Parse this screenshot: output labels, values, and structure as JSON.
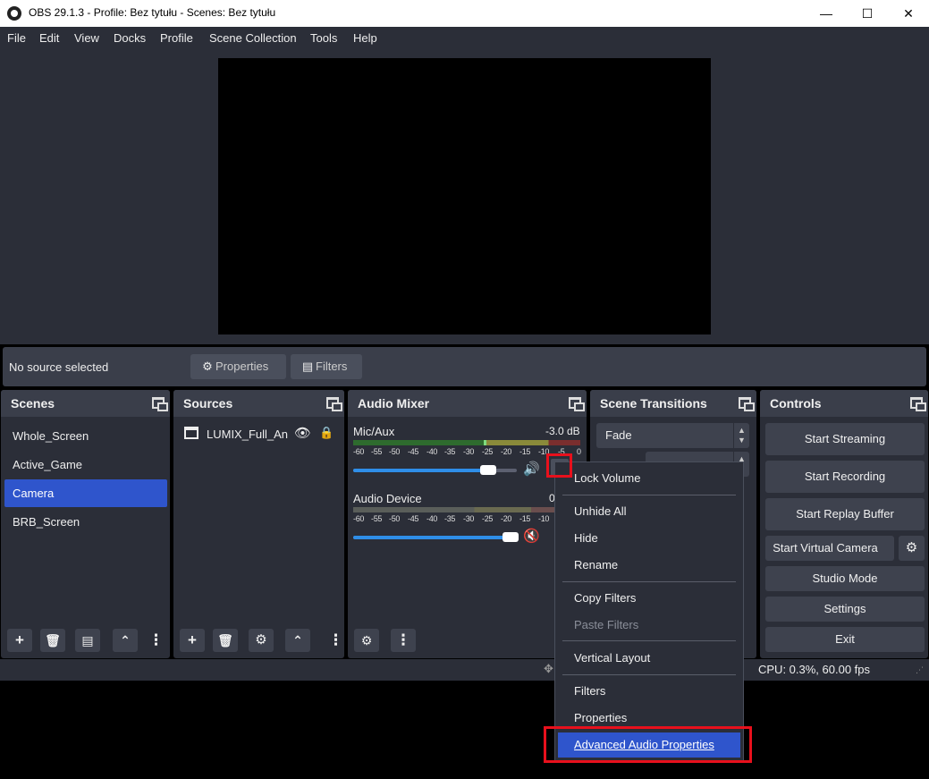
{
  "window": {
    "title": "OBS 29.1.3 - Profile: Bez tytułu - Scenes: Bez tytułu"
  },
  "menu": [
    "File",
    "Edit",
    "View",
    "Docks",
    "Profile",
    "Scene Collection",
    "Tools",
    "Help"
  ],
  "context_bar": {
    "status": "No source selected",
    "properties": "Properties",
    "filters": "Filters"
  },
  "docks": {
    "scenes": {
      "title": "Scenes",
      "items": [
        "Whole_Screen",
        "Active_Game",
        "Camera",
        "BRB_Screen"
      ],
      "selected": "Camera"
    },
    "sources": {
      "title": "Sources",
      "items": [
        "LUMIX_Full_An"
      ]
    },
    "audio_mixer": {
      "title": "Audio Mixer",
      "channels": [
        {
          "name": "Mic/Aux",
          "db": "-3.0 dB",
          "volume": 0.86,
          "muted": false
        },
        {
          "name": "Audio Device",
          "db": "0",
          "volume": 1.0,
          "muted": true
        }
      ],
      "scale": [
        "-60",
        "-55",
        "-50",
        "-45",
        "-40",
        "-35",
        "-30",
        "-25",
        "-20",
        "-15",
        "-10",
        "-5",
        "0"
      ]
    },
    "scene_transitions": {
      "title": "Scene Transitions",
      "transition": "Fade"
    },
    "controls": {
      "title": "Controls",
      "buttons": [
        "Start Streaming",
        "Start Recording",
        "Start Replay Buffer",
        "Start Virtual Camera",
        "Studio Mode",
        "Settings",
        "Exit"
      ]
    }
  },
  "status": {
    "cpu": "CPU: 0.3%, 60.00 fps"
  },
  "context_menu": {
    "items": [
      "Lock Volume",
      "Unhide All",
      "Hide",
      "Rename",
      "Copy Filters",
      "Paste Filters",
      "Vertical Layout",
      "Filters",
      "Properties",
      "Advanced Audio Properties"
    ],
    "disabled": [
      "Paste Filters"
    ],
    "highlighted": "Advanced Audio Properties"
  },
  "colors": {
    "accent": "#2f55cc",
    "annotation": "#e8101c",
    "volume": "#2f8ee8",
    "muted": "#e02030"
  }
}
